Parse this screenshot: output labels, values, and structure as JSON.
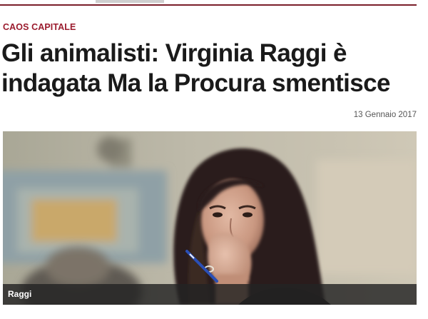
{
  "article": {
    "section": "CAOS CAPITALE",
    "headline": "Gli animalisti: Virginia Raggi è indagata Ma la Procura smentisce",
    "date": "13 Gennaio 2017"
  },
  "image": {
    "caption": "Raggi"
  },
  "colors": {
    "accent": "#9b1c2e",
    "rule": "#7a1f2b",
    "headline": "#1a1a1a",
    "caption_bg": "#232323"
  }
}
